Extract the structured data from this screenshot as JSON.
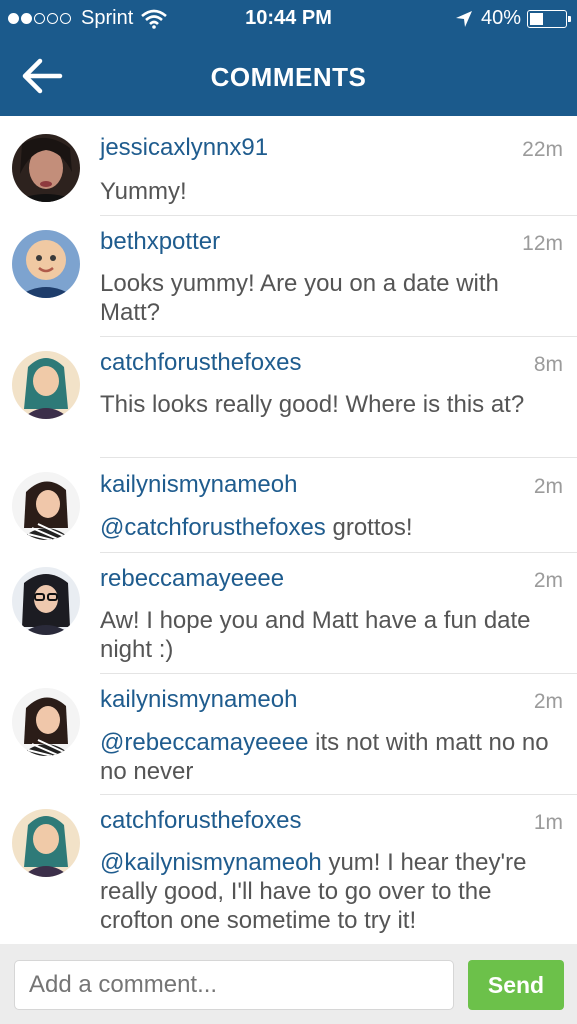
{
  "status_bar": {
    "carrier": "Sprint",
    "time": "10:44 PM",
    "battery": "40%",
    "battery_level": 0.4
  },
  "header": {
    "title": "COMMENTS"
  },
  "comments": [
    {
      "user": "jessicaxlynnx91",
      "time": "22m",
      "mention": "",
      "text": "Yummy!"
    },
    {
      "user": "bethxpotter",
      "time": "12m",
      "mention": "",
      "text": "Looks yummy! Are you on a date with Matt?"
    },
    {
      "user": "catchforusthefoxes",
      "time": "8m",
      "mention": "",
      "text": "This looks really good! Where is this at?"
    },
    {
      "user": "kailynismynameoh",
      "time": "2m",
      "mention": "@catchforusthefoxes",
      "text": " grottos!"
    },
    {
      "user": "rebeccamayeeee",
      "time": "2m",
      "mention": "",
      "text": "Aw! I hope you and Matt have a fun date night :)"
    },
    {
      "user": "kailynismynameoh",
      "time": "2m",
      "mention": "@rebeccamayeeee",
      "text": " its not with matt no no no never"
    },
    {
      "user": "catchforusthefoxes",
      "time": "1m",
      "mention": "@kailynismynameoh",
      "text": " yum! I hear they're really good, I'll have to go over to the crofton one sometime to try it!"
    }
  ],
  "composer": {
    "placeholder": "Add a comment...",
    "send_label": "Send"
  },
  "colors": {
    "header": "#1b5a8c",
    "username": "#1f5c8e",
    "send": "#6cc14a"
  }
}
